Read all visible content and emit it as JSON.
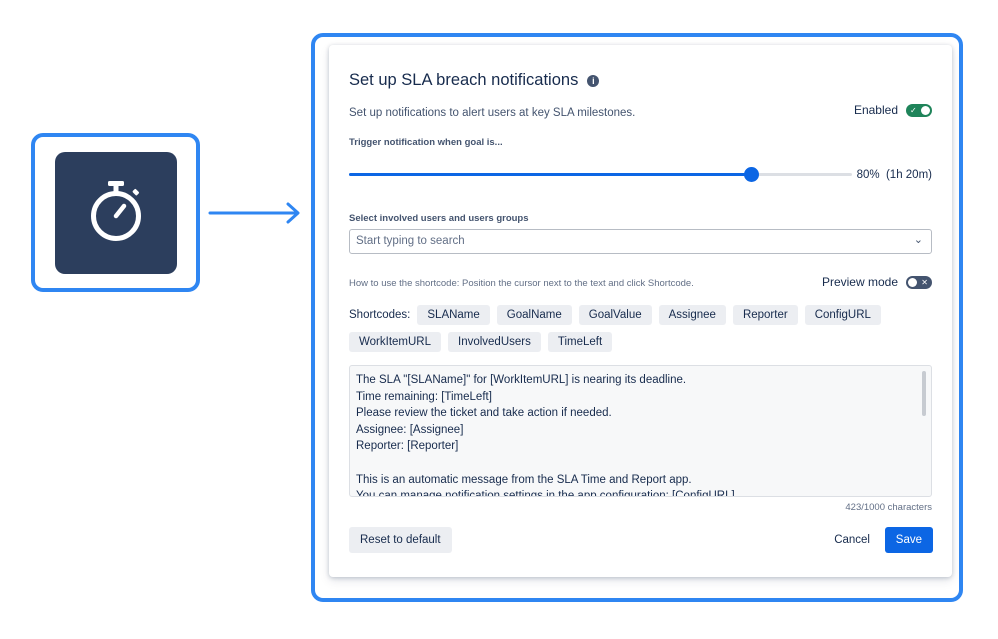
{
  "colors": {
    "accent": "#2f86f2",
    "tile": "#2c3e5d",
    "primary": "#0c66e4",
    "toggle_on": "#1f845a"
  },
  "feature_icon": "stopwatch-icon",
  "dialog": {
    "title": "Set up SLA breach notifications",
    "info_icon": "i",
    "subtitle": "Set up notifications to alert users at key SLA milestones.",
    "enabled": {
      "label": "Enabled",
      "on": true,
      "glyph": "✓"
    },
    "trigger": {
      "label": "Trigger notification when goal is...",
      "percent": 80,
      "value_text": "80%  (1h 20m)"
    },
    "users": {
      "label": "Select involved users and users groups",
      "placeholder": "Start typing to search",
      "chevron": "⌄"
    },
    "howto": "How to use the shortcode: Position the cursor next to the text and click Shortcode.",
    "preview": {
      "label": "Preview mode",
      "on": false,
      "glyph": "✕"
    },
    "shortcodes": {
      "label": "Shortcodes:",
      "row1": [
        "SLAName",
        "GoalName",
        "GoalValue",
        "Assignee",
        "Reporter",
        "ConfigURL"
      ],
      "row2": [
        "WorkItemURL",
        "InvolvedUsers",
        "TimeLeft"
      ]
    },
    "message": "The SLA \"[SLAName]\" for [WorkItemURL] is nearing its deadline.\nTime remaining: [TimeLeft]\nPlease review the ticket and take action if needed.\nAssignee: [Assignee]\nReporter: [Reporter]\n\nThis is an automatic message from the SLA Time and Report app.\nYou can manage notification settings in the app configuration: [ConfigURL]",
    "char_count": "423/1000 characters",
    "buttons": {
      "reset": "Reset to default",
      "cancel": "Cancel",
      "save": "Save"
    }
  }
}
